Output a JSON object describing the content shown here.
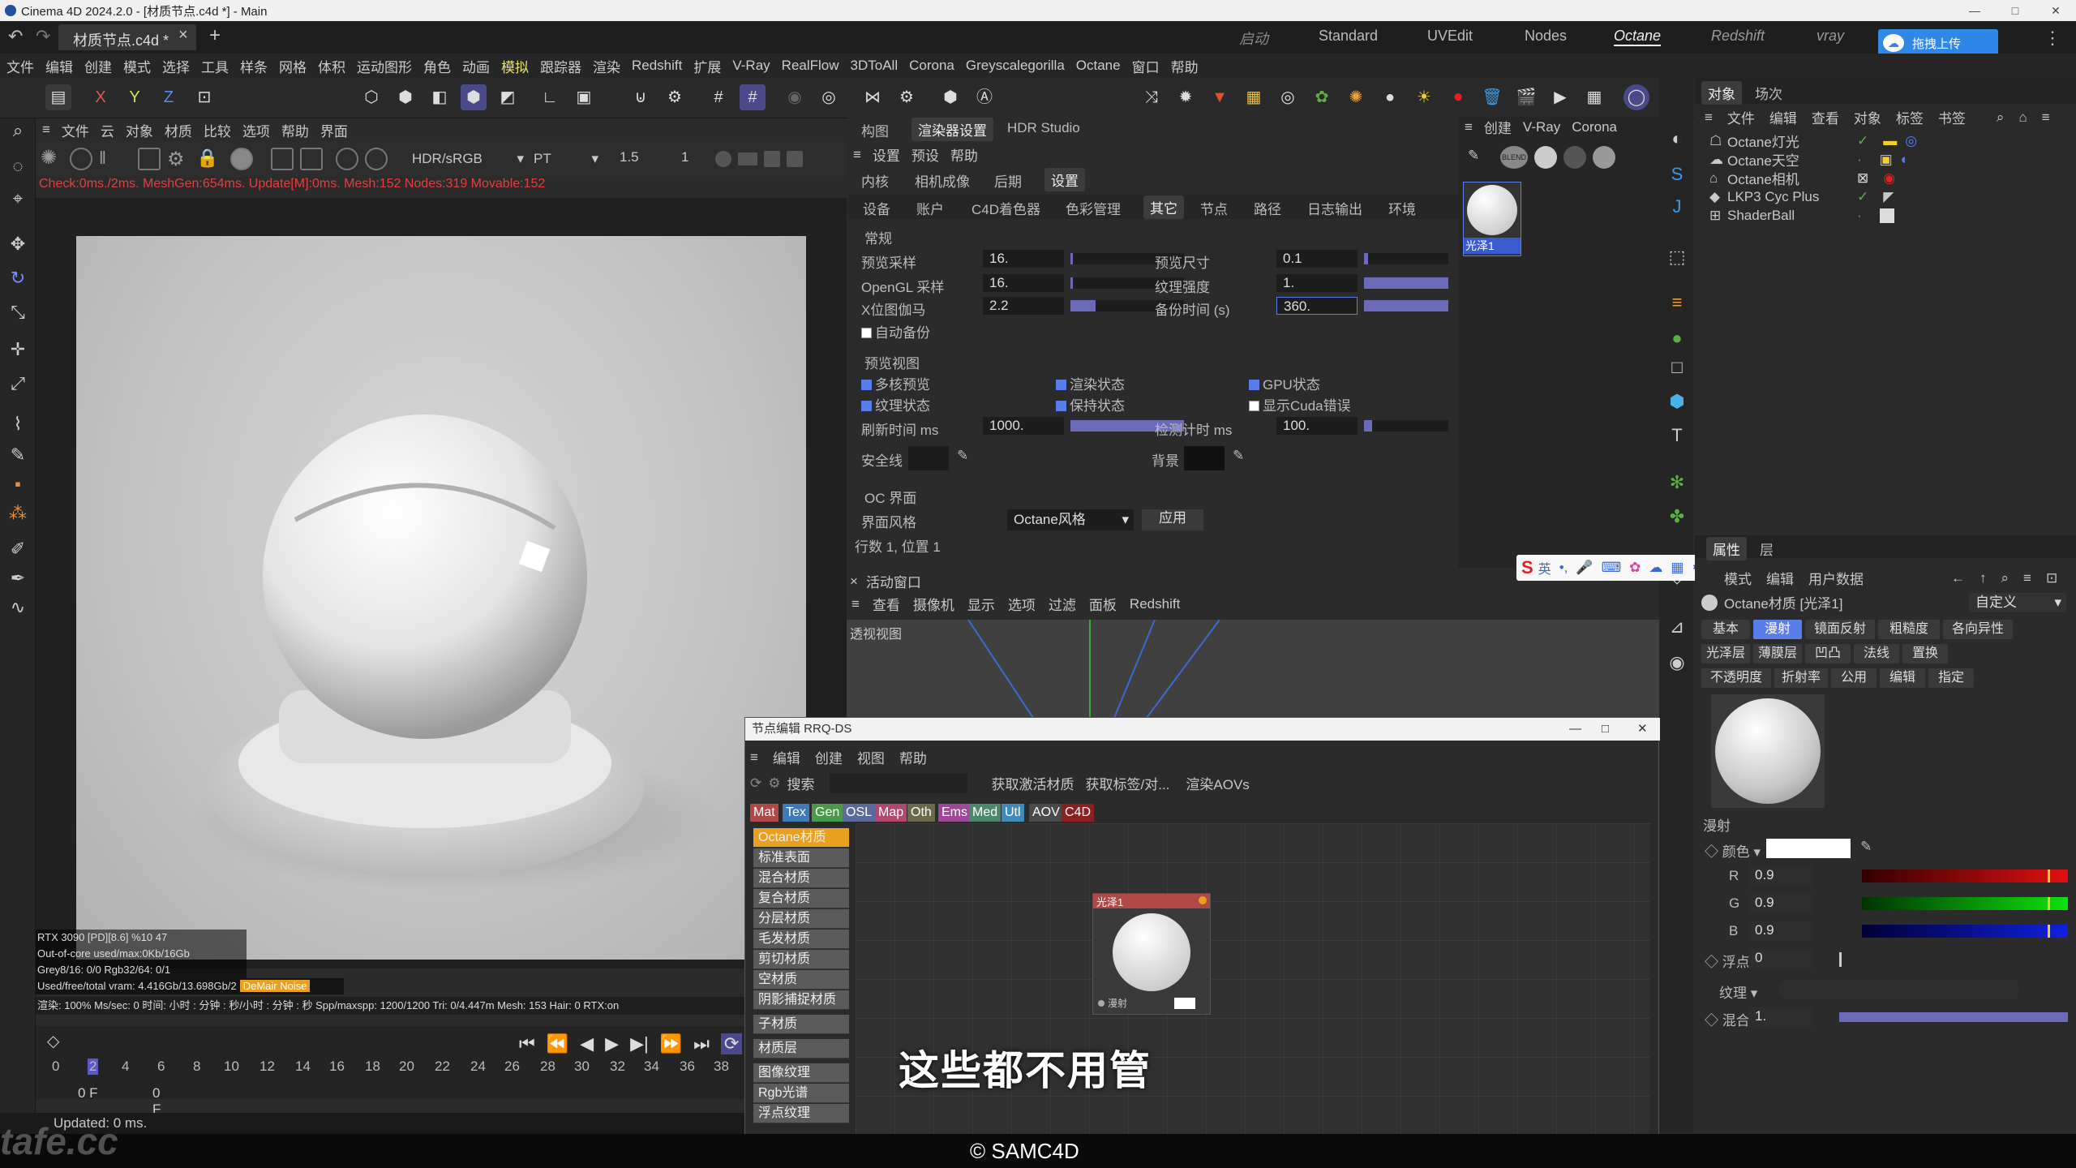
{
  "window": {
    "title": "Cinema 4D 2024.2.0 - [材质节点.c4d *] - Main",
    "controls": [
      "—",
      "□",
      "✕"
    ]
  },
  "document_tab": {
    "label": "材质节点.c4d *",
    "close": "×",
    "add": "+"
  },
  "layouts": [
    "启动",
    "Standard",
    "UVEdit",
    "Nodes",
    "Octane",
    "Redshift",
    "vray"
  ],
  "upload_label": "拖拽上传",
  "menu": [
    "文件",
    "编辑",
    "创建",
    "模式",
    "选择",
    "工具",
    "样条",
    "网格",
    "体积",
    "运动图形",
    "角色",
    "动画",
    "模拟",
    "跟踪器",
    "渲染",
    "Redshift",
    "扩展",
    "V-Ray",
    "RealFlow",
    "3DToAll",
    "Corona",
    "Greyscalegorilla",
    "Octane",
    "窗口",
    "帮助"
  ],
  "axis": {
    "x": "X",
    "y": "Y",
    "z": "Z"
  },
  "viewport": {
    "menu": [
      "文件",
      "云",
      "对象",
      "材质",
      "比较",
      "选项",
      "帮助",
      "界面"
    ],
    "color_space": "HDR/sRGB",
    "kernel": "PT",
    "exposure": "1.5",
    "value2": "1",
    "status": "Check:0ms./2ms. MeshGen:654ms. Update[M]:0ms. Mesh:152 Nodes:319 Movable:152",
    "overlay": [
      "RTX 3090 [PD][8.6]        %10     47",
      "Out-of-core used/max:0Kb/16Gb",
      "Grey8/16: 0/0          Rgb32/64: 0/1",
      "Used/free/total vram: 4.416Gb/13.698Gb/2"
    ],
    "denoise": "DeMair Noise",
    "render_status": "渲染: 100%   Ms/sec: 0   时间: 小时 : 分钟 : 秒/小时 : 分钟 : 秒   Spp/maxspp: 1200/1200  Tri: 0/4.447m  Mesh: 153  Hair: 0   RTX:on"
  },
  "timeline": {
    "ticks": [
      "0",
      "2",
      "4",
      "6",
      "8",
      "10",
      "12",
      "14",
      "16",
      "18",
      "20",
      "22",
      "24",
      "26",
      "28",
      "30",
      "32",
      "34",
      "36",
      "38"
    ],
    "frame_start": "0 F",
    "frame_current": "0 F"
  },
  "status_bar": "Updated: 0 ms.",
  "settings": {
    "top_tabs": [
      "构图",
      "渲染器设置",
      "HDR Studio"
    ],
    "menu": [
      "设置",
      "预设",
      "帮助"
    ],
    "sub_tabs": [
      "内核",
      "相机成像",
      "后期",
      "设置"
    ],
    "cat_tabs": [
      "设备",
      "账户",
      "C4D着色器",
      "色彩管理",
      "其它",
      "节点",
      "路径",
      "日志输出",
      "环境"
    ],
    "section_general": "常规",
    "preview_samples_label": "预览采样",
    "preview_samples": "16.",
    "preview_size_label": "预览尺寸",
    "preview_size": "0.1",
    "opengl_samples_label": "OpenGL 采样",
    "opengl_samples": "16.",
    "texture_strength_label": "纹理强度",
    "texture_strength": "1.",
    "xgamma_label": "X位图伽马",
    "xgamma": "2.2",
    "backup_time_label": "备份时间 (s)",
    "backup_time": "360.",
    "auto_backup": "自动备份",
    "section_preview": "预览视图",
    "checks": [
      "多核预览",
      "渲染状态",
      "GPU状态",
      "纹理状态",
      "保持状态",
      "显示Cuda错误"
    ],
    "refresh_label": "刷新时间 ms",
    "refresh": "1000.",
    "detect_label": "检测计时 ms",
    "detect": "100.",
    "safe_line": "安全线",
    "background": "背景",
    "section_oc": "OC 界面",
    "ui_style_label": "界面风格",
    "ui_style": "Octane风格",
    "apply": "应用",
    "rowpos": "行数 1, 位置 1"
  },
  "material_thumb_label": "光泽1",
  "objects": {
    "tabs": [
      "对象",
      "场次"
    ],
    "menu": [
      "文件",
      "编辑",
      "查看",
      "对象",
      "标签",
      "书签"
    ],
    "items": [
      "Octane灯光",
      "Octane天空",
      "Octane相机",
      "LKP3 Cyc Plus",
      "ShaderBall"
    ]
  },
  "attributes": {
    "tabs": [
      "属性",
      "层"
    ],
    "menu": [
      "模式",
      "编辑",
      "用户数据"
    ],
    "title": "Octane材质 [光泽1]",
    "preset": "自定义",
    "buttons_row1": [
      "基本",
      "漫射",
      "镜面反射",
      "粗糙度",
      "各向异性"
    ],
    "buttons_row2": [
      "光泽层",
      "薄膜层",
      "凹凸",
      "法线",
      "置换"
    ],
    "buttons_row3": [
      "不透明度",
      "折射率",
      "公用",
      "编辑",
      "指定"
    ],
    "section": "漫射",
    "color_label": "颜色",
    "r_label": "R",
    "r": "0.9",
    "g_label": "G",
    "g": "0.9",
    "b_label": "B",
    "b": "0.9",
    "float_label": "浮点",
    "float": "0",
    "texture_label": "纹理",
    "mix_label": "混合",
    "mix": "1."
  },
  "active_window": {
    "title": "活动窗口",
    "menu": [
      "查看",
      "摄像机",
      "显示",
      "选项",
      "过滤",
      "面板",
      "Redshift"
    ],
    "view_label": "透视视图"
  },
  "node_editor": {
    "title": "节点编辑 RRQ-DS",
    "menu": [
      "编辑",
      "创建",
      "视图",
      "帮助"
    ],
    "search": "搜索",
    "actions": [
      "获取激活材质",
      "获取标签/对...",
      "渲染AOVs"
    ],
    "categories": [
      "Mat",
      "Tex",
      "Gen",
      "OSL",
      "Map",
      "Oth",
      "Ems",
      "Med",
      "Utl",
      "AOV",
      "C4D"
    ],
    "category_colors": [
      "#b04848",
      "#3e7ab8",
      "#4a9a4a",
      "#5a6a9a",
      "#b04870",
      "#6a6a4a",
      "#a04898",
      "#4a8a6a",
      "#3e8ab8",
      "#4a4a4a",
      "#8a2020"
    ],
    "items": [
      "Octane材质",
      "标准表面",
      "混合材质",
      "复合材质",
      "分层材质",
      "毛发材质",
      "剪切材质",
      "空材质",
      "阴影捕捉材质"
    ],
    "items2": [
      "子材质",
      "材质层",
      "图像纹理",
      "Rgb光谱",
      "浮点纹理"
    ],
    "node_label": "光泽1",
    "node_port": "漫射"
  },
  "subtitle": "这些都不用管",
  "copyright": "© SAMC4D",
  "watermark": "tafe.cc"
}
